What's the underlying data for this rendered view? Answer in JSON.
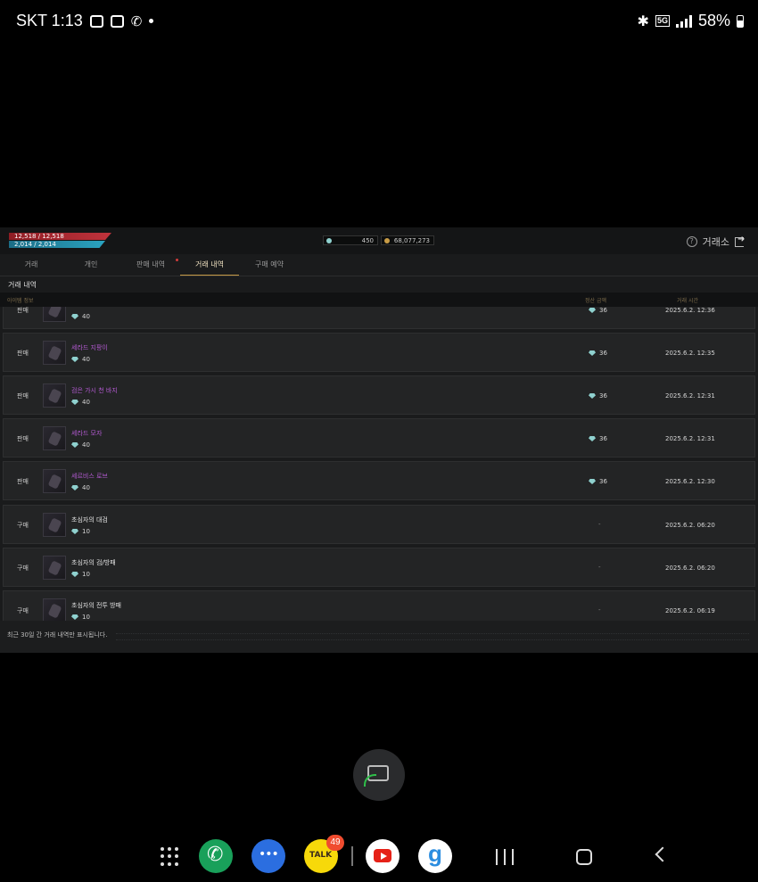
{
  "status_bar": {
    "carrier_time": "SKT 1:13",
    "network": "5G",
    "battery": "58%"
  },
  "game": {
    "hp": "12,518 / 12,518",
    "mp": "2,014 / 2,014",
    "currency_gem": "450",
    "currency_gold": "68,077,273",
    "window_title": "거래소",
    "tabs": [
      "거래",
      "개인",
      "판매 내역",
      "거래 내역",
      "구매 예약"
    ],
    "active_tab": "거래 내역",
    "section_title": "거래 내역",
    "columns": {
      "item": "아이템 정보",
      "price": "정산 금액",
      "time": "거래 시간"
    },
    "rows": [
      {
        "type": "판매",
        "name": "",
        "cost": "40",
        "price": "36",
        "time": "2025.6.2. 12:36",
        "rarity": "rare"
      },
      {
        "type": "판매",
        "name": "세라드 지팡이",
        "cost": "40",
        "price": "36",
        "time": "2025.6.2. 12:35",
        "rarity": "rare"
      },
      {
        "type": "판매",
        "name": "검은 가시 천 바지",
        "cost": "40",
        "price": "36",
        "time": "2025.6.2. 12:31",
        "rarity": "rare"
      },
      {
        "type": "판매",
        "name": "세라드 모자",
        "cost": "40",
        "price": "36",
        "time": "2025.6.2. 12:31",
        "rarity": "rare"
      },
      {
        "type": "판매",
        "name": "세르비스 로브",
        "cost": "40",
        "price": "36",
        "time": "2025.6.2. 12:30",
        "rarity": "rare"
      },
      {
        "type": "구매",
        "name": "초심자의 대검",
        "cost": "10",
        "price": "-",
        "time": "2025.6.2. 06:20",
        "rarity": "common"
      },
      {
        "type": "구매",
        "name": "초심자의 검/방패",
        "cost": "10",
        "price": "-",
        "time": "2025.6.2. 06:20",
        "rarity": "common"
      },
      {
        "type": "구매",
        "name": "초심자의 전투 방패",
        "cost": "10",
        "price": "-",
        "time": "2025.6.2. 06:19",
        "rarity": "common"
      }
    ],
    "footer_note": "최근 30일 간 거래 내역만 표시됩니다."
  },
  "dock": {
    "talk_label": "TALK",
    "talk_badge": "49"
  },
  "colors": {
    "accent_gold": "#c79b46",
    "rare_purple": "#b35ad1",
    "hp_red": "#c0333c",
    "mp_cyan": "#2aa3c0"
  }
}
